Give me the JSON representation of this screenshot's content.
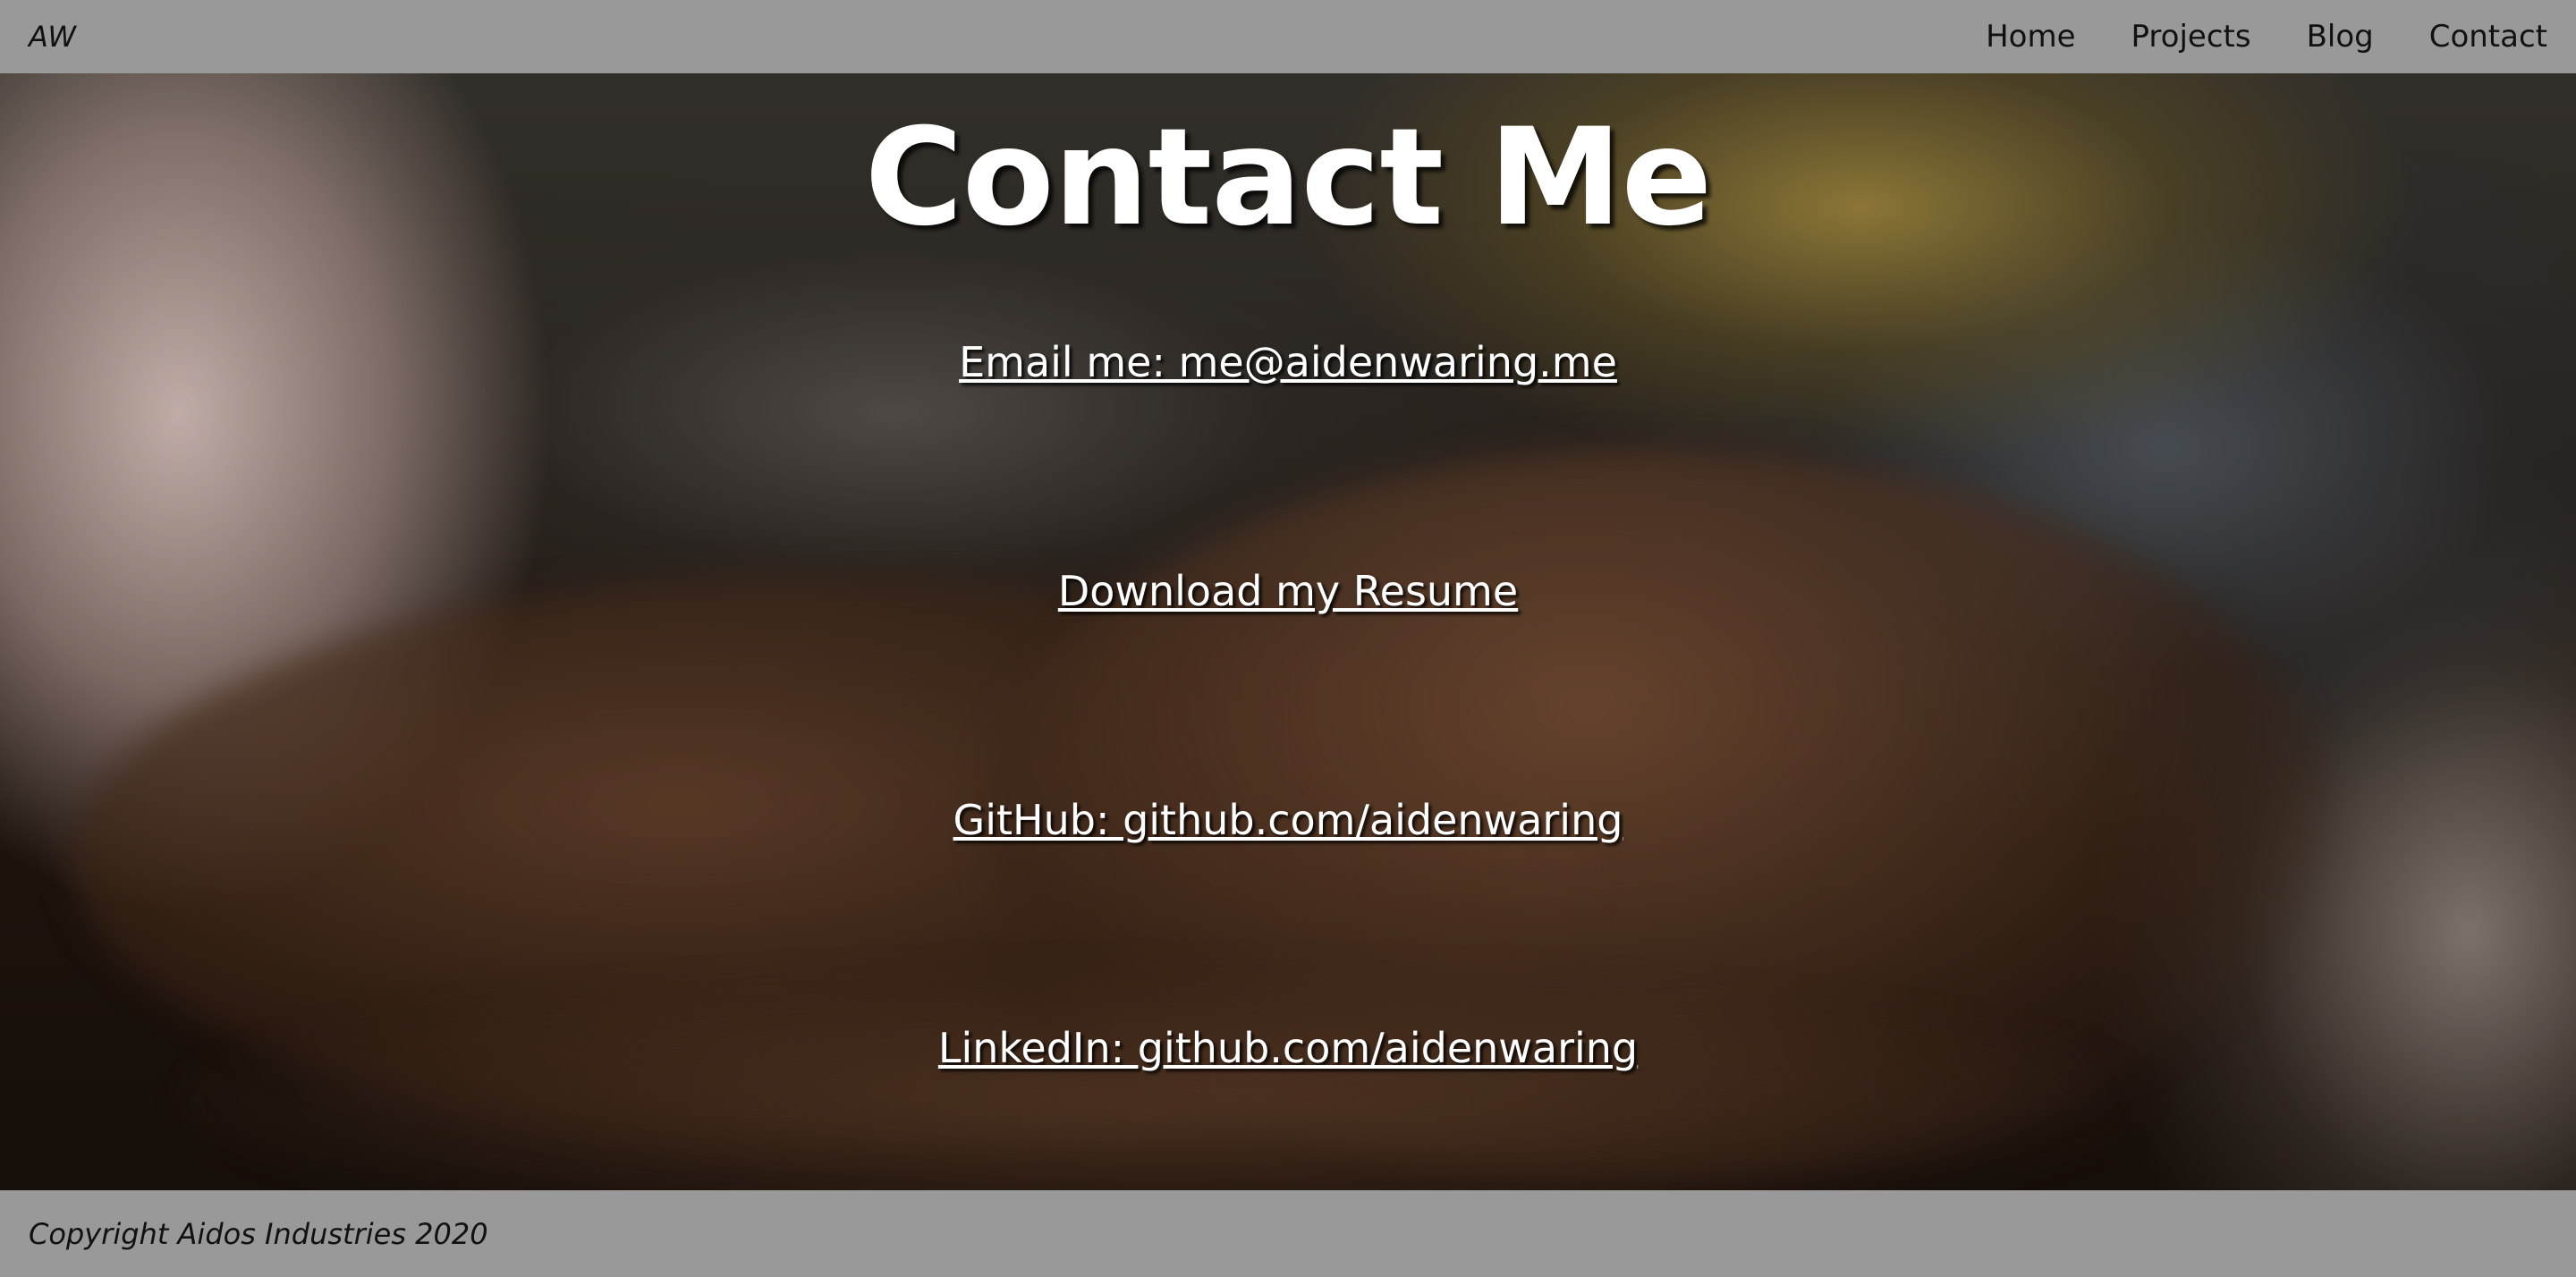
{
  "header": {
    "logo": "AW",
    "nav": [
      {
        "label": "Home"
      },
      {
        "label": "Projects"
      },
      {
        "label": "Blog"
      },
      {
        "label": "Contact"
      }
    ]
  },
  "main": {
    "title": "Contact Me",
    "links": [
      {
        "label": "Email me: me@aidenwaring.me"
      },
      {
        "label": "Download my Resume"
      },
      {
        "label": "GitHub: github.com/aidenwaring"
      },
      {
        "label": "LinkedIn: github.com/aidenwaring"
      }
    ]
  },
  "footer": {
    "copyright": "Copyright Aidos Industries 2020"
  }
}
